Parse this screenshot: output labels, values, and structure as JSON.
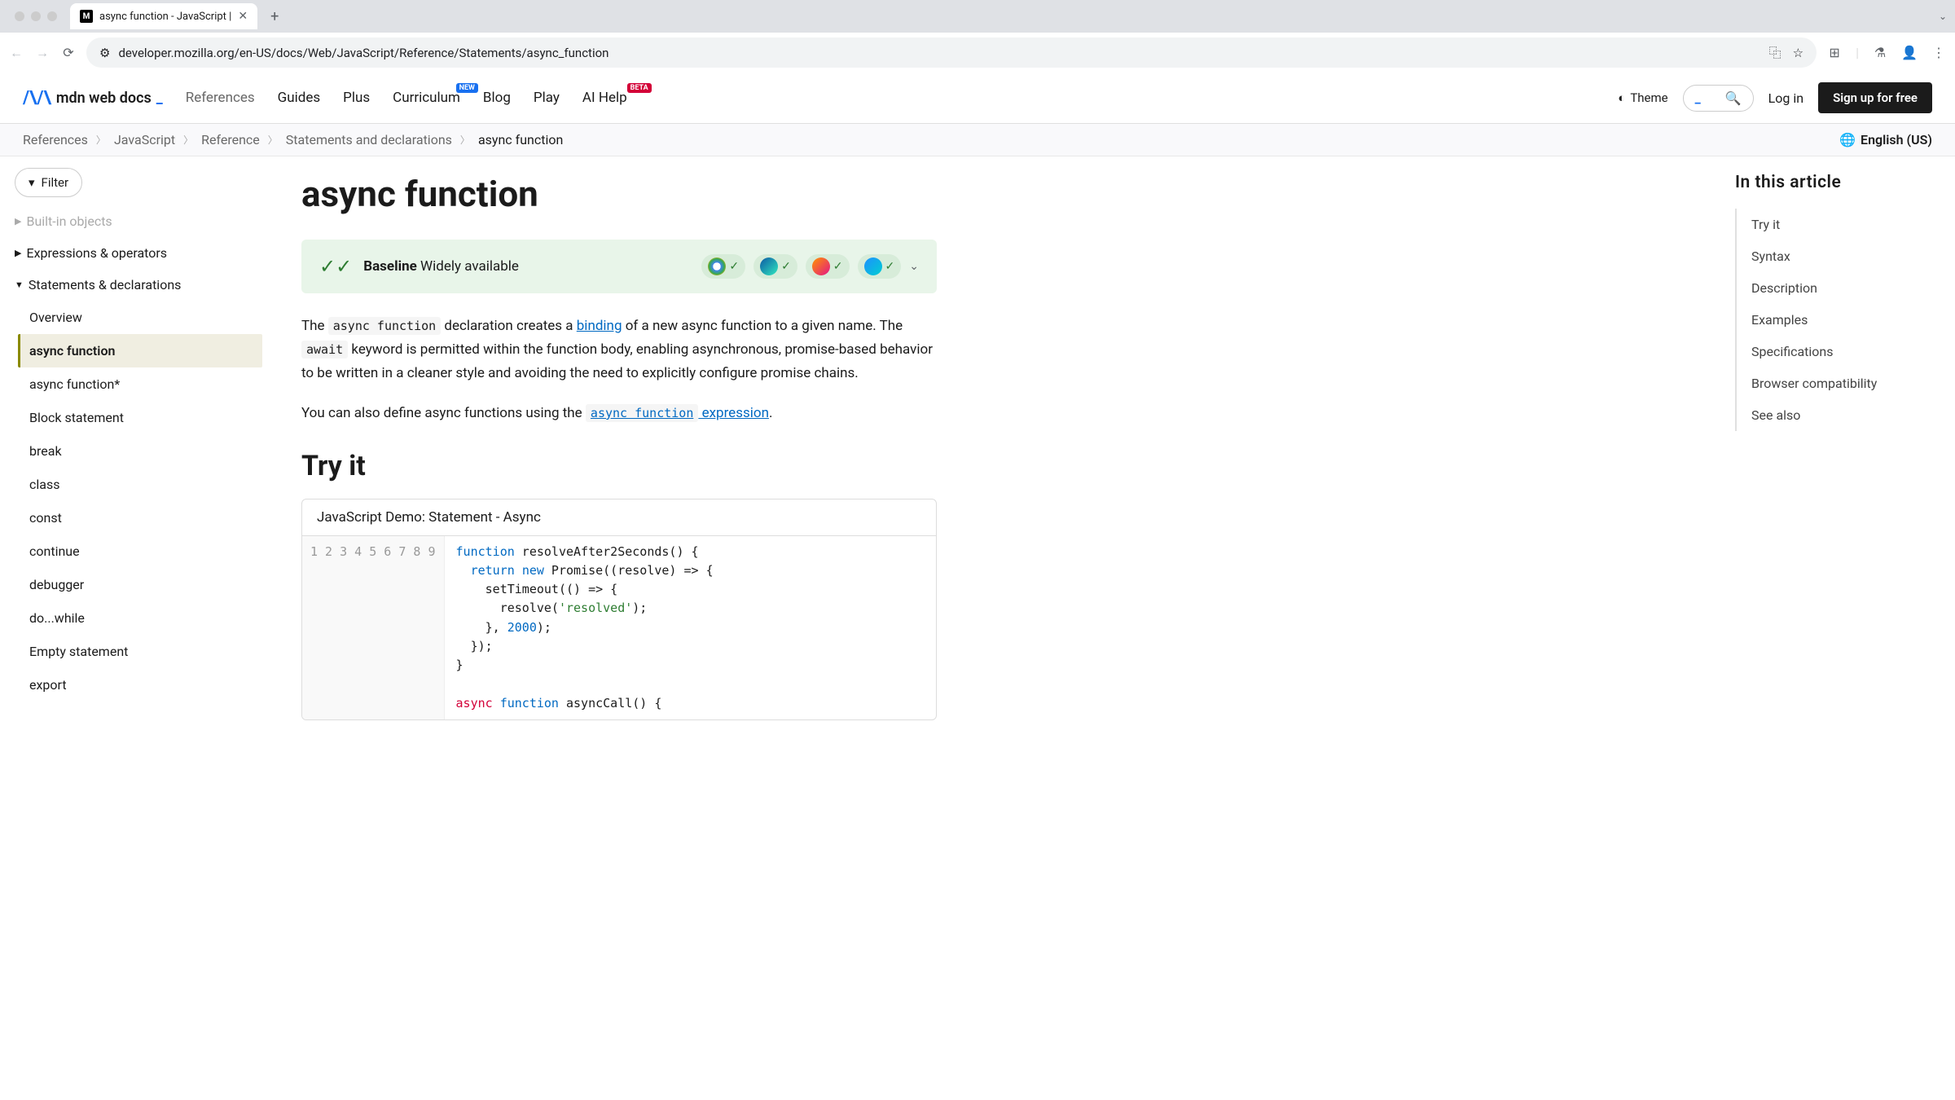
{
  "browser": {
    "tab_title": "async function - JavaScript |",
    "url": "developer.mozilla.org/en-US/docs/Web/JavaScript/Reference/Statements/async_function"
  },
  "mdn_header": {
    "logo_text": "mdn web docs",
    "nav": [
      "References",
      "Guides",
      "Plus",
      "Curriculum",
      "Blog",
      "Play",
      "AI Help"
    ],
    "badges": {
      "curriculum": "NEW",
      "aihelp": "BETA"
    },
    "theme": "Theme",
    "login": "Log in",
    "signup": "Sign up for free"
  },
  "breadcrumb": {
    "items": [
      "References",
      "JavaScript",
      "Reference",
      "Statements and declarations",
      "async function"
    ],
    "language": "English (US)"
  },
  "sidebar": {
    "filter": "Filter",
    "sections": [
      {
        "label": "Built-in objects",
        "faded": true,
        "open": false,
        "tri": "▶"
      },
      {
        "label": "Expressions & operators",
        "open": false,
        "tri": "▶"
      },
      {
        "label": "Statements & declarations",
        "open": true,
        "tri": "▼"
      }
    ],
    "items": [
      "Overview",
      "async function",
      "async function*",
      "Block statement",
      "break",
      "class",
      "const",
      "continue",
      "debugger",
      "do...while",
      "Empty statement",
      "export"
    ],
    "active": "async function"
  },
  "content": {
    "title": "async function",
    "baseline_bold": "Baseline",
    "baseline_rest": " Widely available",
    "para1_parts": {
      "t1": "The ",
      "c1": "async function",
      "t2": " declaration creates a ",
      "l1": "binding",
      "t3": " of a new async function to a given name. The ",
      "c2": "await",
      "t4": " keyword is permitted within the function body, enabling asynchronous, promise-based behavior to be written in a cleaner style and avoiding the need to explicitly configure promise chains."
    },
    "para2_parts": {
      "t1": "You can also define async functions using the ",
      "c1": "async function",
      "l1": " expression",
      "t2": "."
    },
    "h2_tryit": "Try it",
    "demo_title": "JavaScript Demo: Statement - Async",
    "code_lines": [
      {
        "n": "1",
        "html": "<span class='kw'>function</span> resolveAfter2Seconds() {"
      },
      {
        "n": "2",
        "html": "  <span class='kw'>return</span> <span class='kw'>new</span> Promise((resolve) =&gt; {"
      },
      {
        "n": "3",
        "html": "    setTimeout(() =&gt; {"
      },
      {
        "n": "4",
        "html": "      resolve(<span class='str'>'resolved'</span>);"
      },
      {
        "n": "5",
        "html": "    }, <span class='num'>2000</span>);"
      },
      {
        "n": "6",
        "html": "  });"
      },
      {
        "n": "7",
        "html": "}"
      },
      {
        "n": "8",
        "html": ""
      },
      {
        "n": "9",
        "html": "<span class='kw2'>async</span> <span class='kw'>function</span> asyncCall() {"
      }
    ]
  },
  "toc": {
    "title": "In this article",
    "items": [
      "Try it",
      "Syntax",
      "Description",
      "Examples",
      "Specifications",
      "Browser compatibility",
      "See also"
    ]
  }
}
